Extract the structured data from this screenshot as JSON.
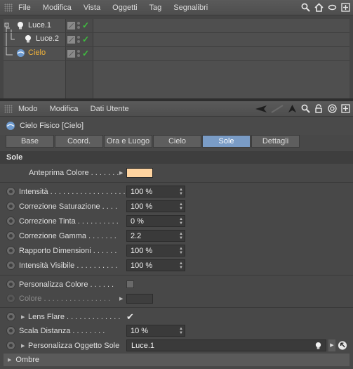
{
  "menubar": {
    "items": [
      "File",
      "Modifica",
      "Vista",
      "Oggetti",
      "Tag",
      "Segnalibri"
    ]
  },
  "objects": [
    {
      "name": "Luce.1",
      "selected": false,
      "icon": "light-bulb-icon"
    },
    {
      "name": "Luce.2",
      "selected": false,
      "icon": "light-bulb-icon"
    },
    {
      "name": "Cielo",
      "selected": true,
      "icon": "sky-sphere-icon"
    }
  ],
  "am_menu": {
    "items": [
      "Modo",
      "Modifica",
      "Dati Utente"
    ]
  },
  "object_title": "Cielo Fisico [Cielo]",
  "tabs": [
    {
      "label": "Base",
      "active": false
    },
    {
      "label": "Coord.",
      "active": false
    },
    {
      "label": "Ora e Luogo",
      "active": false
    },
    {
      "label": "Cielo",
      "active": false
    },
    {
      "label": "Sole",
      "active": true
    },
    {
      "label": "Dettagli",
      "active": false
    }
  ],
  "section_title": "Sole",
  "params": {
    "anteprima": {
      "label": "Anteprima Colore . . . . . . .",
      "color": "#ffd4a0"
    },
    "intensita": {
      "label": "Intensità . . . . . . . . . . . . . . . . . .",
      "value": "100 %"
    },
    "saturazione": {
      "label": "Correzione Saturazione . . . .",
      "value": "100 %"
    },
    "tinta": {
      "label": "Correzione Tinta . . . . . . . . . .",
      "value": "0 %"
    },
    "gamma": {
      "label": "Correzione Gamma . . . . . . .",
      "value": "2.2"
    },
    "dimensioni": {
      "label": "Rapporto Dimensioni . . . . . .",
      "value": "100 %"
    },
    "visibile": {
      "label": "Intensità Visibile . . . . . . . . . .",
      "value": "100 %"
    },
    "personalizza_colore": {
      "label": "Personalizza Colore . . . . . .",
      "checked": false
    },
    "colore": {
      "label": "Colore . . . . . . . . . . . . . . . .",
      "color": "#3e3e3e"
    },
    "lens_flare": {
      "label": "Lens Flare . . . . . . . . . . . . .",
      "checked": true
    },
    "scala_distanza": {
      "label": "Scala Distanza . . . . . . . .",
      "value": "10 %"
    },
    "oggetto_sole": {
      "label": "Personalizza Oggetto Sole",
      "value": "Luce.1"
    }
  },
  "footer": {
    "label": "Ombre"
  },
  "colors": {
    "accent_tab": "#7a9cc6",
    "selected_object": "#f3b43a",
    "check": "#3ec23e"
  }
}
